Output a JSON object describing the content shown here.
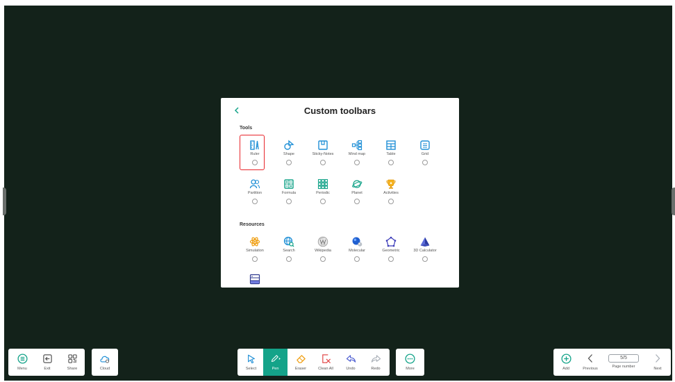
{
  "dialog": {
    "title": "Custom toolbars",
    "tools_label": "Tools",
    "resources_label": "Resources",
    "tools_row1": [
      {
        "label": "Ruler",
        "icon": "ruler-icon"
      },
      {
        "label": "Shape",
        "icon": "shape-icon"
      },
      {
        "label": "Sticky-Notes",
        "icon": "sticky-notes-icon"
      },
      {
        "label": "Mind map",
        "icon": "mind-map-icon"
      },
      {
        "label": "Table",
        "icon": "table-icon"
      },
      {
        "label": "Grid",
        "icon": "grid-icon"
      }
    ],
    "tools_row2": [
      {
        "label": "Partition",
        "icon": "partition-icon"
      },
      {
        "label": "Formula",
        "icon": "formula-icon"
      },
      {
        "label": "Periodic",
        "icon": "periodic-table-icon"
      },
      {
        "label": "Planet",
        "icon": "planet-icon"
      },
      {
        "label": "Activities",
        "icon": "trophy-icon"
      }
    ],
    "resources": [
      {
        "label": "Simulation",
        "icon": "atom-icon"
      },
      {
        "label": "Search",
        "icon": "globe-search-icon"
      },
      {
        "label": "Wikipedia",
        "icon": "wikipedia-icon"
      },
      {
        "label": "Molecular",
        "icon": "molecule-icon"
      },
      {
        "label": "Geometric",
        "icon": "geometric-icon"
      },
      {
        "label": "3D Calculator",
        "icon": "pyramid-icon"
      }
    ],
    "extra_resource_icon": "panel-icon"
  },
  "left_toolbar": {
    "menu": "Menu",
    "exit": "Exit",
    "share": "Share",
    "cloud": "Cloud"
  },
  "center_toolbar": {
    "select": "Select",
    "pen": "Pen",
    "eraser": "Eraser",
    "clean_all": "Clean All",
    "undo": "Undo",
    "redo": "Redo",
    "more": "More"
  },
  "right_toolbar": {
    "add": "Add",
    "previous": "Previous",
    "page_value": "5/5",
    "page_label": "Page number",
    "next": "Next"
  },
  "colors": {
    "board": "#13221a",
    "accent": "#14a389",
    "icon_blue": "#1f8fd6",
    "highlight": "#e8242a"
  }
}
